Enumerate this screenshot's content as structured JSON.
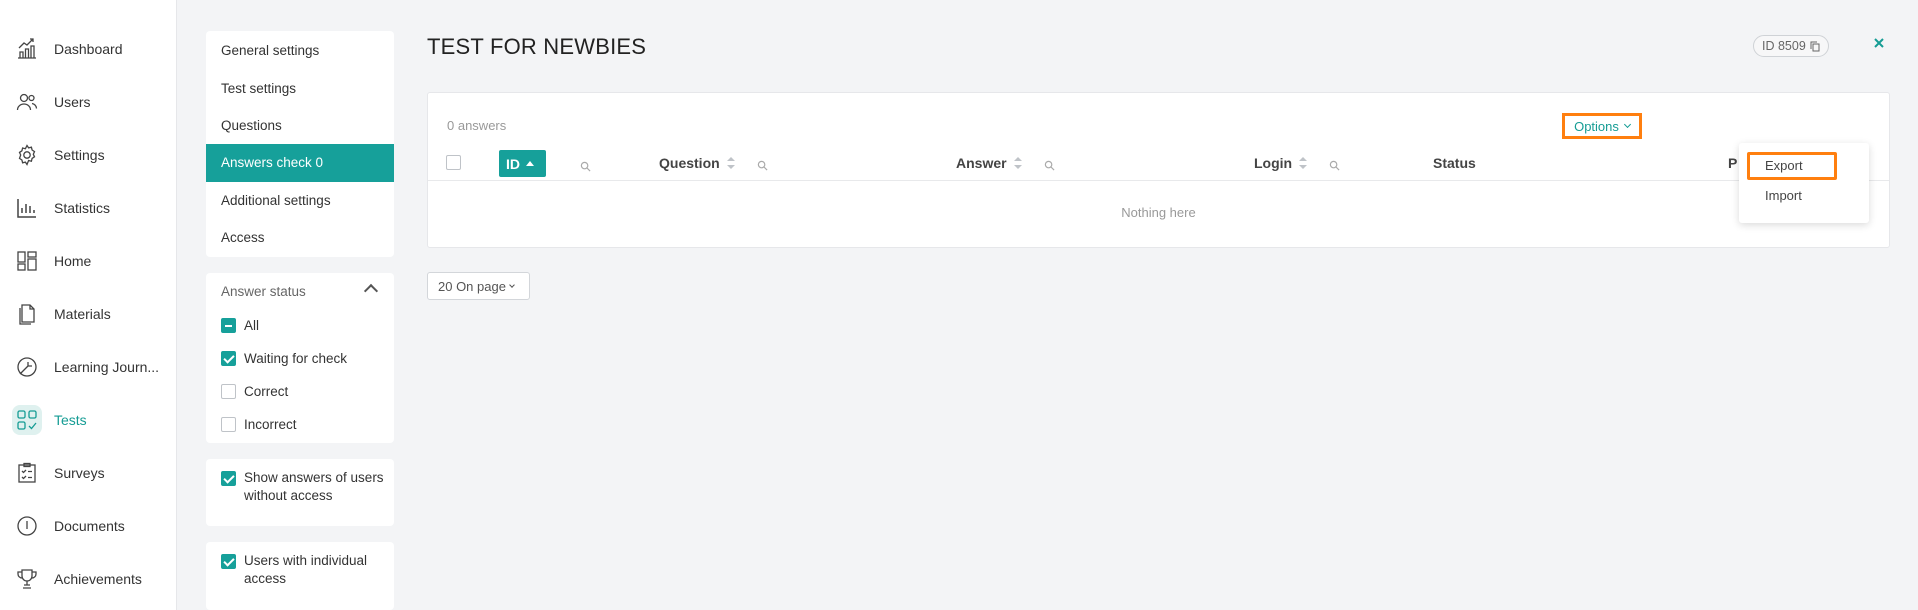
{
  "nav": {
    "items": [
      {
        "label": "Dashboard",
        "icon": "dashboard-icon"
      },
      {
        "label": "Users",
        "icon": "users-icon"
      },
      {
        "label": "Settings",
        "icon": "gear-icon"
      },
      {
        "label": "Statistics",
        "icon": "bar-chart-icon"
      },
      {
        "label": "Home",
        "icon": "home-layout-icon"
      },
      {
        "label": "Materials",
        "icon": "document-copy-icon"
      },
      {
        "label": "Learning Journ...",
        "icon": "journey-icon"
      },
      {
        "label": "Tests",
        "icon": "tests-grid-icon",
        "active": true
      },
      {
        "label": "Surveys",
        "icon": "clipboard-icon"
      },
      {
        "label": "Documents",
        "icon": "info-circle-icon"
      },
      {
        "label": "Achievements",
        "icon": "trophy-icon"
      }
    ]
  },
  "settings_menu": {
    "items": [
      "General settings",
      "Test settings",
      "Questions",
      "Answers check 0",
      "Additional settings",
      "Access"
    ],
    "active": "Answers check 0"
  },
  "filters": {
    "title": "Answer status",
    "options": [
      {
        "label": "All",
        "state": "indeterminate"
      },
      {
        "label": "Waiting for check",
        "state": "checked"
      },
      {
        "label": "Correct",
        "state": "unchecked"
      },
      {
        "label": "Incorrect",
        "state": "unchecked"
      }
    ],
    "show_without_access": "Show answers of users without access",
    "individual_access": "Users with individual access"
  },
  "header": {
    "title": "TEST FOR NEWBIES",
    "id_badge": "ID 8509"
  },
  "table": {
    "count_text": "0 answers",
    "options_label": "Options",
    "columns": [
      "ID",
      "Question",
      "Answer",
      "Login",
      "Status",
      "P"
    ],
    "empty_text": "Nothing here"
  },
  "pagination": {
    "per_page_label": "20 On page"
  },
  "options_menu": {
    "items": [
      "Export",
      "Import"
    ]
  },
  "colors": {
    "accent": "#16a09a",
    "highlight": "#ff7f0f"
  }
}
